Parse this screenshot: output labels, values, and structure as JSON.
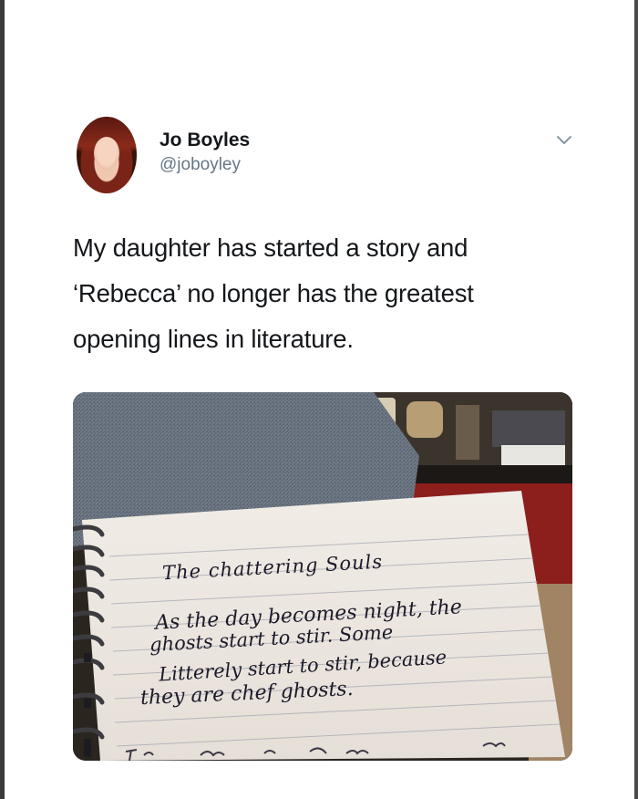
{
  "tweet": {
    "author": {
      "display_name": "Jo Boyles",
      "handle": "@joboyley"
    },
    "menu_icon": "chevron-down-icon",
    "text_lines": [
      "My daughter has started a story and",
      "‘Rebecca’ no longer has the greatest",
      "opening lines in literature."
    ]
  },
  "photo": {
    "notebook": {
      "title": "The chattering Souls",
      "lines": [
        "As the day becomes night, the",
        "ghosts start to stir. Some",
        "Litterely start to stir, because",
        "they are chef ghosts."
      ]
    }
  }
}
